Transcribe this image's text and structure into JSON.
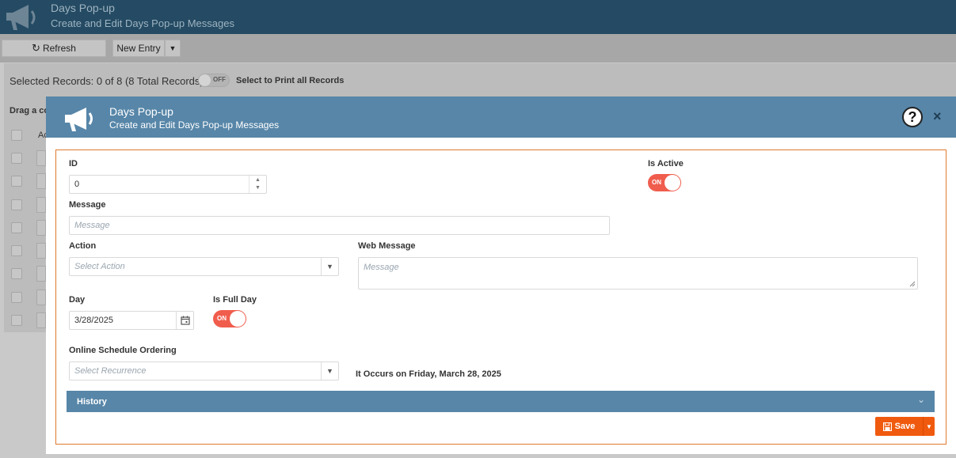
{
  "background": {
    "app_title": "Days Pop-up",
    "app_subtitle": "Create and Edit Days Pop-up Messages",
    "toolbar": {
      "refresh_label": "Refresh",
      "new_entry_label": "New Entry",
      "caret": "▼"
    },
    "grid": {
      "selected_records": "Selected Records: 0 of 8 (8 Total Records)",
      "toggle_label": "OFF",
      "print_label": "Select to Print all Records",
      "drag_label": "Drag a co",
      "column_header": "Ac"
    }
  },
  "modal": {
    "title": "Days Pop-up",
    "subtitle": "Create and Edit Days Pop-up Messages",
    "help_glyph": "?",
    "close_glyph": "×",
    "form": {
      "id": {
        "label": "ID",
        "value": "0"
      },
      "is_active": {
        "label": "Is Active",
        "toggle": "ON"
      },
      "message": {
        "label": "Message",
        "placeholder": "Message"
      },
      "action": {
        "label": "Action",
        "placeholder": "Select Action"
      },
      "web_message": {
        "label": "Web Message",
        "placeholder": "Message"
      },
      "day": {
        "label": "Day",
        "value": "3/28/2025"
      },
      "is_full_day": {
        "label": "Is Full Day",
        "toggle": "ON"
      },
      "online_schedule": {
        "label": "Online Schedule Ordering",
        "placeholder": "Select Recurrence"
      },
      "occurs_text": "It Occurs on Friday, March 28, 2025"
    },
    "history_label": "History",
    "save_label": "Save"
  },
  "colors": {
    "header_dark": "#244b63",
    "header_modal": "#5786a8",
    "accent_orange": "#f05a0e",
    "toggle_on": "#f05d4d"
  }
}
